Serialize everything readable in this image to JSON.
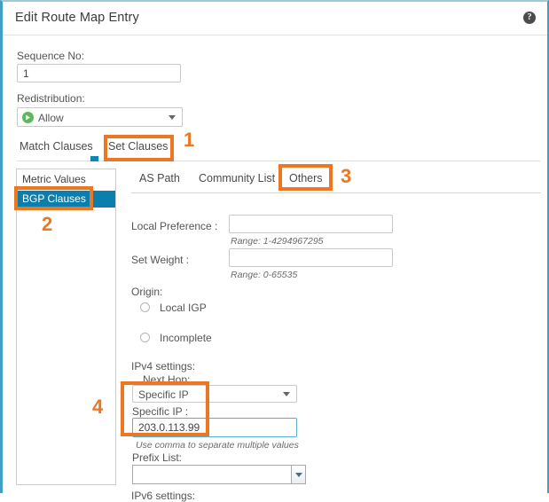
{
  "window": {
    "title": "Edit Route Map Entry",
    "help_icon": "help-circle-icon",
    "help_glyph": "?"
  },
  "form": {
    "sequence_label": "Sequence No:",
    "sequence_value": "1",
    "sequence_placeholder": "",
    "redistribution_label": "Redistribution:",
    "redistribution_value": "Allow",
    "redistribution_icon": "green-allow-arrow-icon"
  },
  "outer_tabs": [
    {
      "label": "Match Clauses",
      "active": false
    },
    {
      "label": "Set Clauses",
      "active": true
    }
  ],
  "side_list": [
    {
      "label": "Metric Values",
      "selected": false
    },
    {
      "label": "BGP Clauses",
      "selected": true
    }
  ],
  "inner_tabs": [
    {
      "label": "AS Path",
      "active": false
    },
    {
      "label": "Community List",
      "active": false
    },
    {
      "label": "Others",
      "active": true
    }
  ],
  "others_panel": {
    "local_preference_label": "Local Preference :",
    "local_preference_value": "",
    "local_preference_hint": "Range: 1-4294967295",
    "set_weight_label": "Set Weight :",
    "set_weight_value": "",
    "set_weight_hint": "Range: 0-65535",
    "origin_label": "Origin:",
    "origin_options": [
      {
        "label": "Local IGP",
        "selected": false
      },
      {
        "label": "Incomplete",
        "selected": false
      }
    ],
    "ipv4_settings_label": "IPv4 settings:",
    "next_hop_label": "Next Hop:",
    "next_hop_value": "Specific IP",
    "specific_ip_label": "Specific IP :",
    "specific_ip_value": "203.0.113.99",
    "specific_ip_hint": "Use comma to separate multiple values",
    "prefix_list_label": "Prefix List:",
    "prefix_list_value": "",
    "ipv6_settings_label": "IPv6 settings:"
  },
  "annotations": [
    {
      "number": "1",
      "target": "Set Clauses tab"
    },
    {
      "number": "2",
      "target": "BGP Clauses list item"
    },
    {
      "number": "3",
      "target": "Others tab"
    },
    {
      "number": "4",
      "target": "Next Hop Specific IP fields"
    }
  ],
  "colors": {
    "accent_teal": "#3f9fc4",
    "selection_blue": "#0c7ead",
    "annotation_orange": "#ec7723",
    "allow_green": "#5cb85c",
    "focus_border": "#57aed0"
  }
}
